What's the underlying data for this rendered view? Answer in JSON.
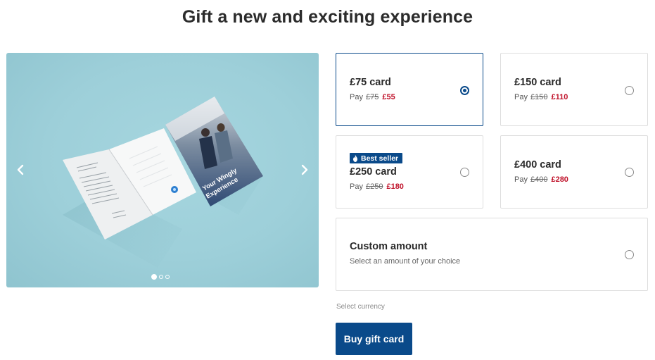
{
  "page": {
    "title": "Gift a new and exciting experience"
  },
  "carousel": {
    "image_alt": "Greeting card mockup",
    "card_cover_text": "Your Wingly Experience",
    "slide_count": 3,
    "active_slide": 1
  },
  "options": [
    {
      "label": "£75 card",
      "pay_prefix": "Pay",
      "old_price": "£75",
      "new_price": "£55",
      "selected": true
    },
    {
      "label": "£150 card",
      "pay_prefix": "Pay",
      "old_price": "£150",
      "new_price": "£110",
      "selected": false
    },
    {
      "label": "£250 card",
      "pay_prefix": "Pay",
      "old_price": "£250",
      "new_price": "£180",
      "selected": false,
      "badge": "Best seller"
    },
    {
      "label": "£400 card",
      "pay_prefix": "Pay",
      "old_price": "£400",
      "new_price": "£280",
      "selected": false
    }
  ],
  "custom": {
    "label": "Custom amount",
    "hint": "Select an amount of your choice"
  },
  "currency": {
    "label": "Select currency"
  },
  "buy_button": {
    "label": "Buy gift card"
  },
  "colors": {
    "brand": "#0a4a8a",
    "discount_price": "#c0122a",
    "carousel_bg": "#9dcfd9"
  }
}
